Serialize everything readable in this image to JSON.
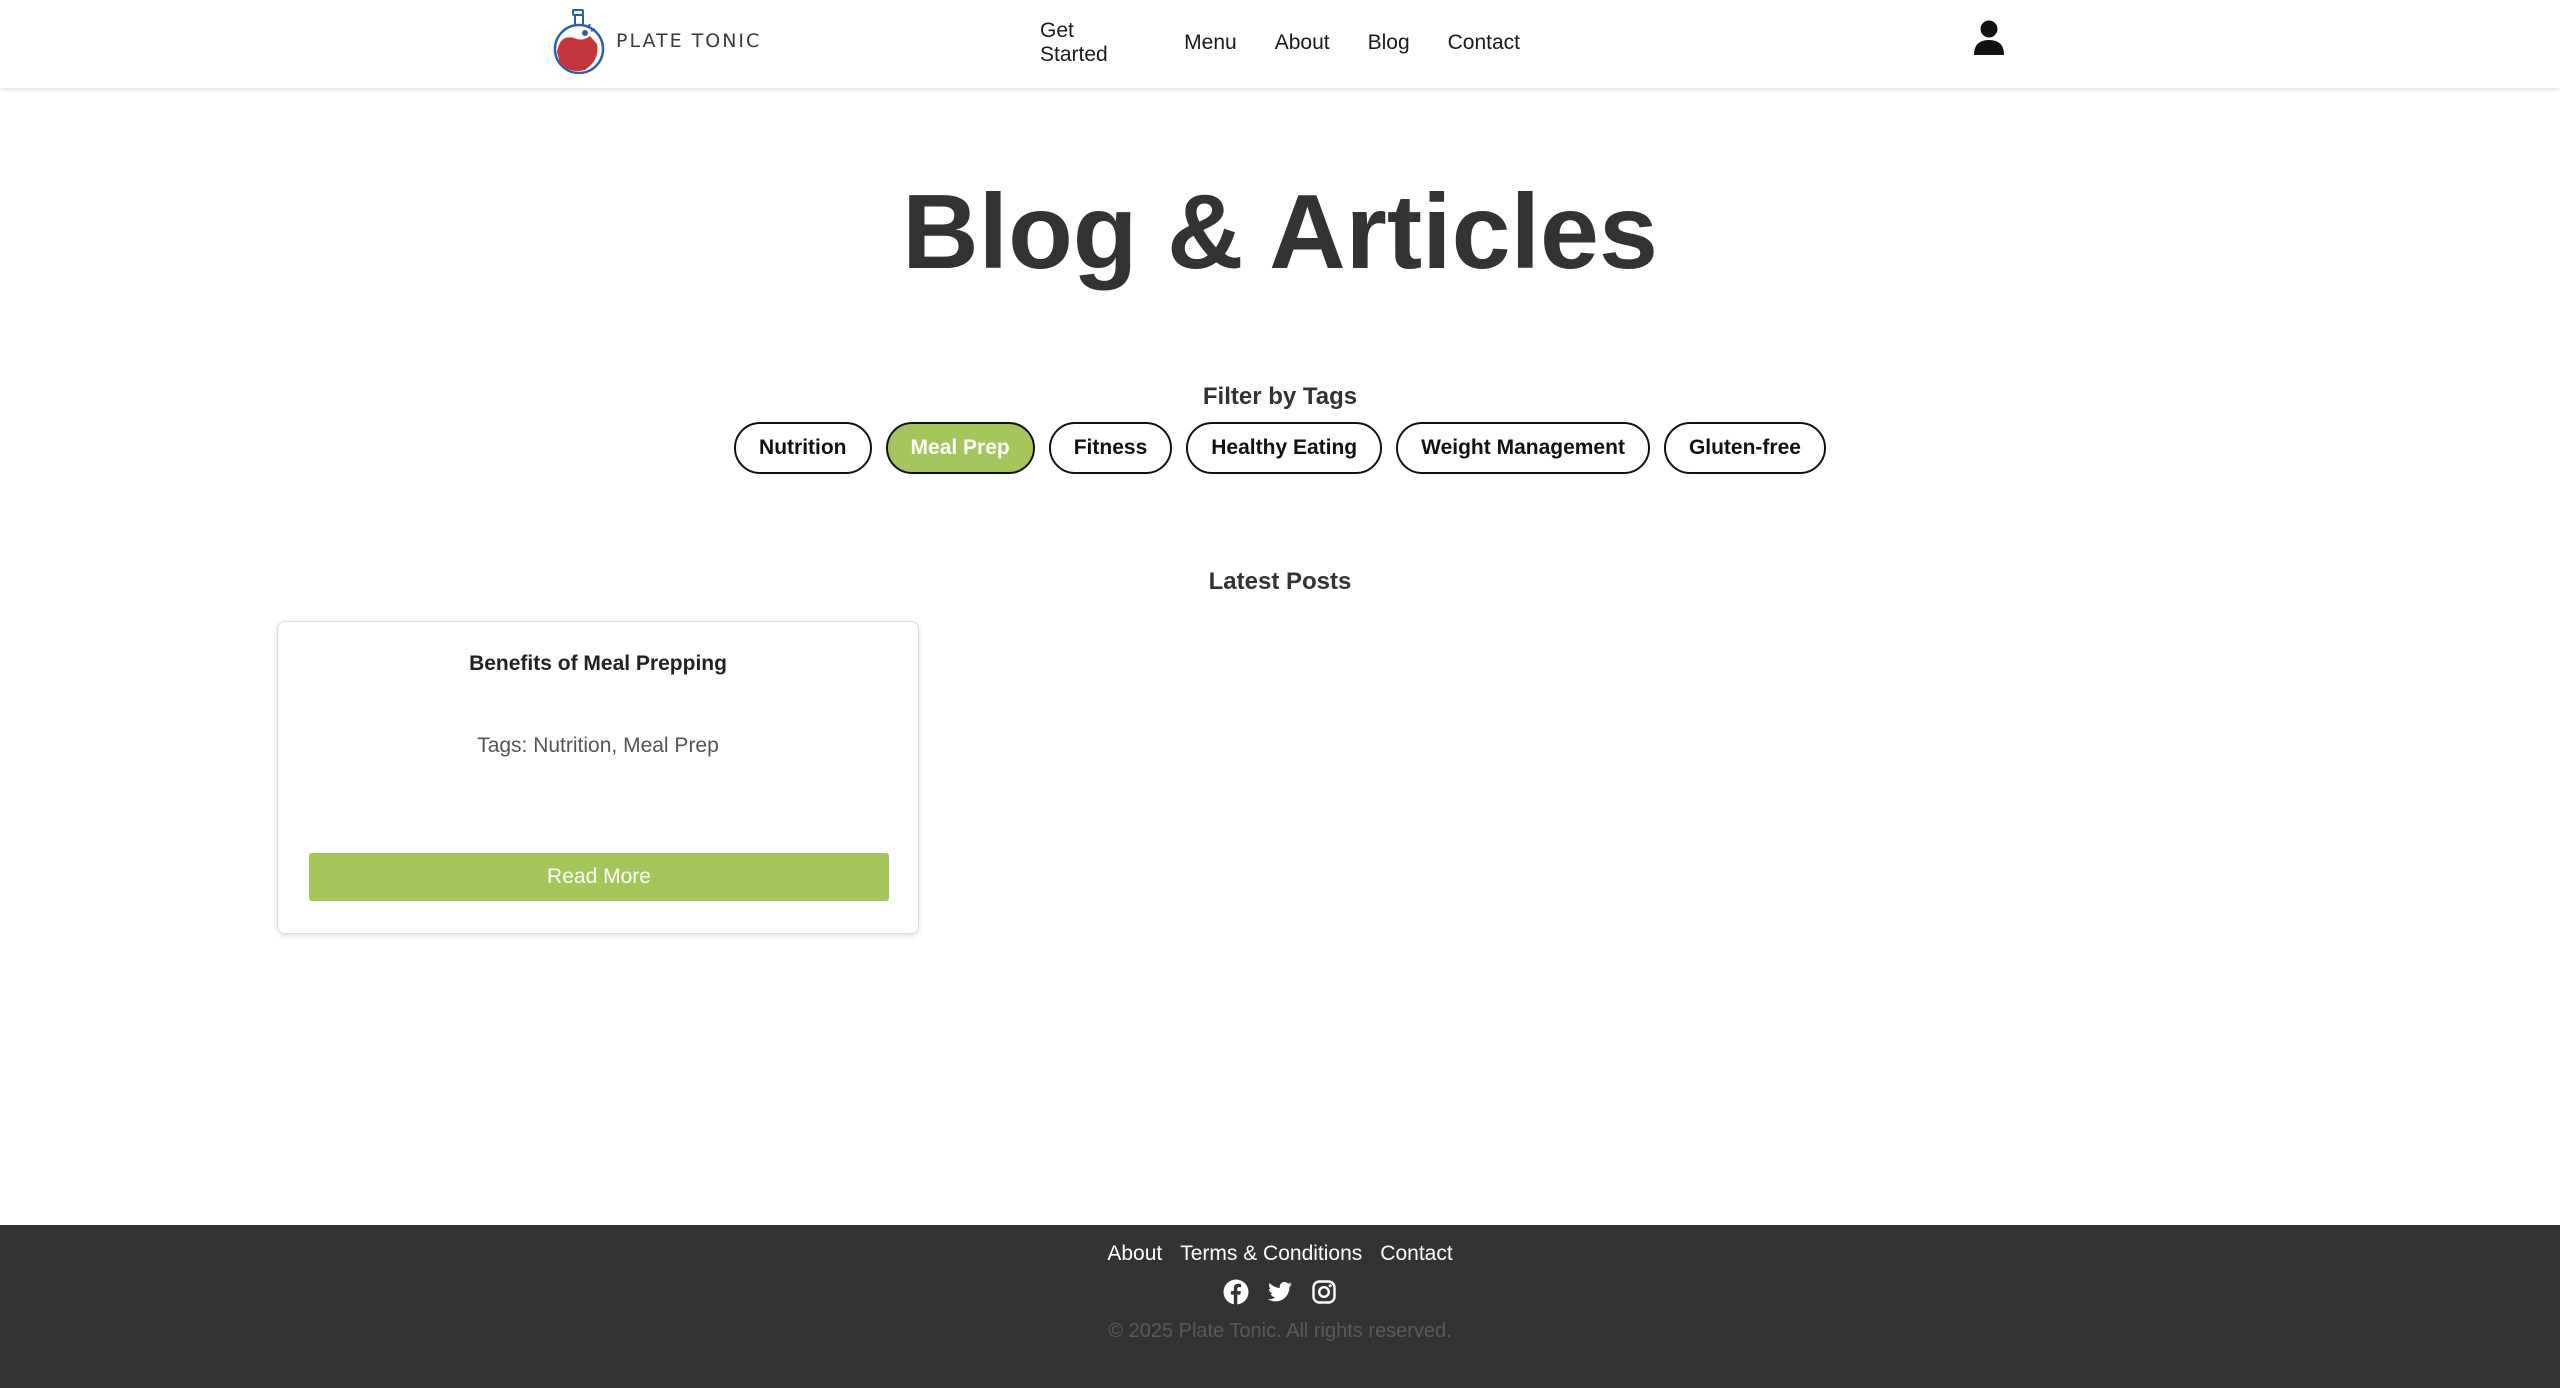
{
  "header": {
    "logo_text": "PLATE TONIC",
    "nav": [
      "Get Started",
      "Menu",
      "About",
      "Blog",
      "Contact"
    ],
    "user_icon": "user-icon"
  },
  "main": {
    "title": "Blog & Articles",
    "filter_heading": "Filter by Tags",
    "tags": [
      {
        "label": "Nutrition",
        "active": false
      },
      {
        "label": "Meal Prep",
        "active": true
      },
      {
        "label": "Fitness",
        "active": false
      },
      {
        "label": "Healthy Eating",
        "active": false
      },
      {
        "label": "Weight Management",
        "active": false
      },
      {
        "label": "Gluten-free",
        "active": false
      }
    ],
    "posts_heading": "Latest Posts",
    "posts": [
      {
        "title": "Benefits of Meal Prepping",
        "tags": "Tags: Nutrition, Meal Prep",
        "button": "Read More"
      }
    ]
  },
  "footer": {
    "links": [
      "About",
      "Terms & Conditions",
      "Contact"
    ],
    "socials": [
      "facebook-icon",
      "twitter-icon",
      "instagram-icon"
    ],
    "copyright": "© 2025 Plate Tonic. All rights reserved."
  },
  "colors": {
    "accent": "#a5c65a",
    "text": "#333333",
    "footer_bg": "#333333",
    "logo_red": "#c4363c",
    "logo_blue": "#2d5fa8"
  }
}
